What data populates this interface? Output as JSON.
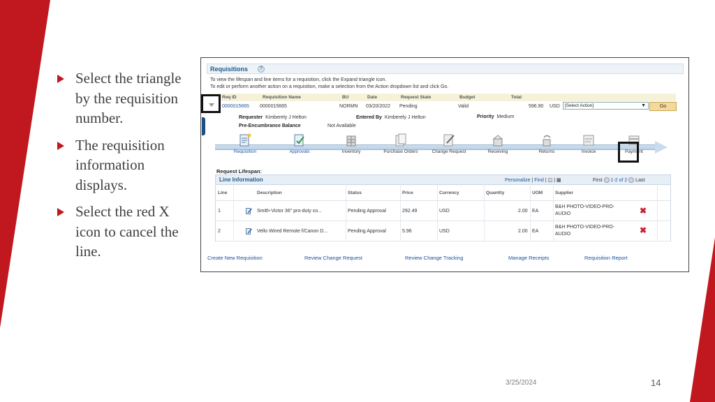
{
  "bullets": [
    "Select the triangle by the requisition number.",
    "The requisition information displays.",
    "Select the red X icon to cancel the line."
  ],
  "footer": {
    "date": "3/25/2024",
    "page": "14"
  },
  "colors": {
    "accent_red": "#c0181e",
    "link_blue": "#1a53a0",
    "title_blue": "#1f5a8c"
  },
  "app": {
    "title": "Requisitions",
    "help_icon": "?",
    "instructions": [
      "To view the lifespan and line items for a requisition, click the Expand triangle icon.",
      "To edit or perform another action on a requisition, make a selection from the Action dropdown list and click Go."
    ],
    "columns": [
      "Req ID",
      "Requisition Name",
      "BU",
      "Date",
      "Request State",
      "Budget",
      "Total"
    ],
    "row": {
      "req_id": "0000015665",
      "name": "0000015665",
      "bu": "NORMN",
      "date": "03/20/2022",
      "state": "Pending",
      "budget": "Valid",
      "total": "596.90",
      "currency": "USD",
      "action_placeholder": "[Select Action]",
      "go_label": "Go"
    },
    "details": {
      "requester_label": "Requester",
      "requester": "Kimberely J Helton",
      "entered_by_label": "Entered By",
      "entered_by": "Kimberely J Helton",
      "priority_label": "Priority",
      "priority": "Medium",
      "pre_enc_label": "Pre-Encumbrance Balance",
      "pre_enc": "Not Available"
    },
    "lifespan": {
      "title": "Request Lifespan:",
      "stages": [
        {
          "label": "Requisition",
          "icon": "requisition-icon"
        },
        {
          "label": "Approvals",
          "icon": "approvals-icon"
        },
        {
          "label": "Inventory",
          "icon": "inventory-icon"
        },
        {
          "label": "Purchase Orders",
          "icon": "purchase-orders-icon"
        },
        {
          "label": "Change Request",
          "icon": "change-request-icon"
        },
        {
          "label": "Receiving",
          "icon": "receiving-icon"
        },
        {
          "label": "Returns",
          "icon": "returns-icon"
        },
        {
          "label": "Invoice",
          "icon": "invoice-icon"
        },
        {
          "label": "Payment",
          "icon": "payment-icon"
        }
      ]
    },
    "line_info": {
      "title": "Line Information",
      "personalize": "Personalize",
      "find": "Find",
      "first": "First",
      "range": "1-2 of 2",
      "last": "Last",
      "columns": [
        "Line",
        "Description",
        "Status",
        "Price",
        "Currency",
        "Quantity",
        "UOM",
        "Supplier"
      ],
      "rows": [
        {
          "line": "1",
          "description": "Smith-Victor 36\" pro-duty co...",
          "status": "Pending Approval",
          "price": "292.49",
          "currency": "USD",
          "quantity": "2.00",
          "uom": "EA",
          "supplier1": "B&H PHOTO-VIDEO-PRO-",
          "supplier2": "AUDIO"
        },
        {
          "line": "2",
          "description": "Vello Wired Remote f/Canon D...",
          "status": "Pending Approval",
          "price": "5.96",
          "currency": "USD",
          "quantity": "2.00",
          "uom": "EA",
          "supplier1": "B&H PHOTO-VIDEO-PRO-",
          "supplier2": "AUDIO"
        }
      ]
    },
    "bottom_links": [
      "Create New Requisition",
      "Review Change Request",
      "Review Change Tracking",
      "Manage Receipts",
      "Requisition Report"
    ]
  }
}
